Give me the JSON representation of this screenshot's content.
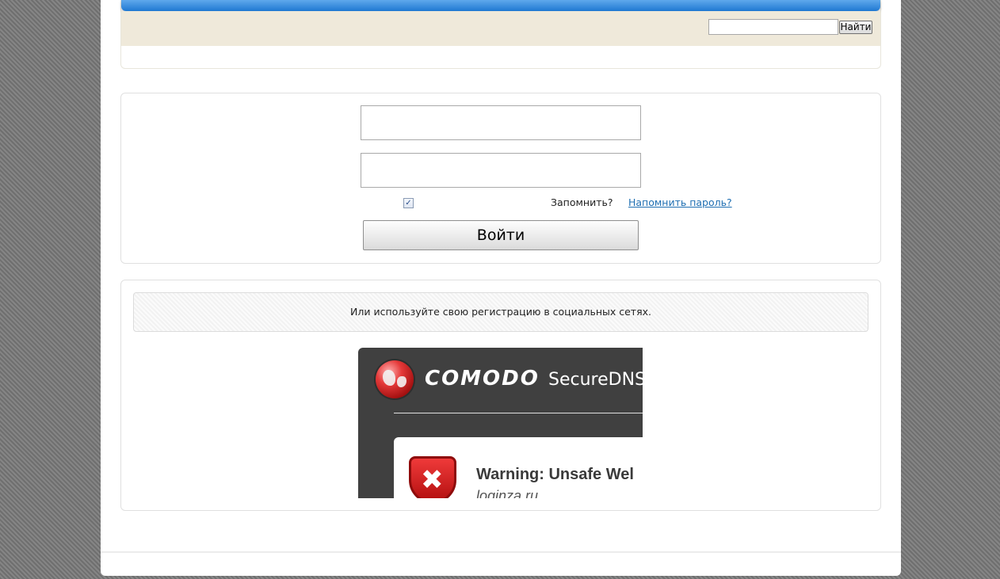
{
  "header": {
    "search": {
      "value": "",
      "placeholder": ""
    },
    "search_button_label": "Найти",
    "colors": {
      "accent_bar": "#1f78d1",
      "toolbar_background": "#efe9da"
    }
  },
  "login": {
    "login_field": {
      "value": "",
      "placeholder": ""
    },
    "password_field": {
      "value": "",
      "placeholder": ""
    },
    "remember_checked": true,
    "remember_label": "Запомнить?",
    "forgot_password_link": "Напомнить пароль?",
    "submit_label": "Войти"
  },
  "social": {
    "note": "Или используйте свою регистрацию в социальных сетях.",
    "blocked_frame": {
      "brand": "COMODO",
      "product": "SecureDNS",
      "warning_title": "Warning: Unsafe Wel",
      "warning_domain": "loginza.ru",
      "icons": {
        "logo": "globe-icon",
        "warning": "error-shield-icon"
      },
      "colors": {
        "frame_background": "#404040",
        "shield": "#d81f1f"
      }
    }
  }
}
